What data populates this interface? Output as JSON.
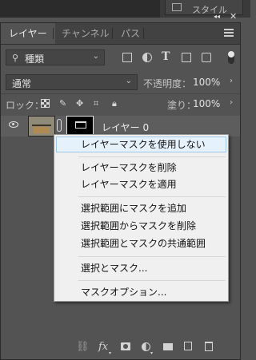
{
  "top_panel": {
    "tab_label": "スタイル"
  },
  "tabs": [
    {
      "label": "レイヤー",
      "active": true
    },
    {
      "label": "チャンネル",
      "active": false
    },
    {
      "label": "パス",
      "active": false
    }
  ],
  "filter": {
    "kind_label": "種類"
  },
  "blend": {
    "mode": "通常",
    "opacity_label": "不透明度：",
    "opacity_value": "100%"
  },
  "lock": {
    "label": "ロック：",
    "fill_label": "塗り：",
    "fill_value": "100%"
  },
  "layer": {
    "name": "レイヤー 0"
  },
  "context_menu": {
    "items": [
      "レイヤーマスクを使用しない",
      "レイヤーマスクを削除",
      "レイヤーマスクを適用",
      "選択範囲にマスクを追加",
      "選択範囲からマスクを削除",
      "選択範囲とマスクの共通範囲",
      "選択とマスク...",
      "マスクオプション..."
    ],
    "highlighted_index": 0
  },
  "icons": {
    "fx": "fx",
    "collapse": "◂◂",
    "close": "✕"
  }
}
